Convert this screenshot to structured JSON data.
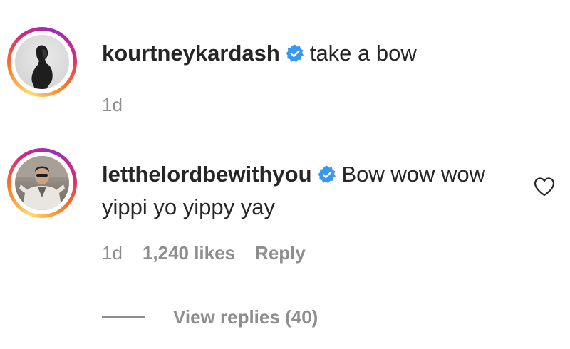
{
  "comments": [
    {
      "username": "kourtneykardash",
      "verified": true,
      "text": "take a bow",
      "time": "1d"
    },
    {
      "username": "letthelordbewithyou",
      "verified": true,
      "text": "Bow wow wow yippi yo yippy yay",
      "time": "1d",
      "likes": "1,240 likes",
      "reply_label": "Reply"
    }
  ],
  "view_replies": "View replies (40)",
  "colors": {
    "text": "#262626",
    "muted": "#8e8e8e",
    "verified_blue": "#3897f0"
  },
  "icons": {
    "verified": "verified-badge-icon",
    "like": "heart-icon"
  }
}
